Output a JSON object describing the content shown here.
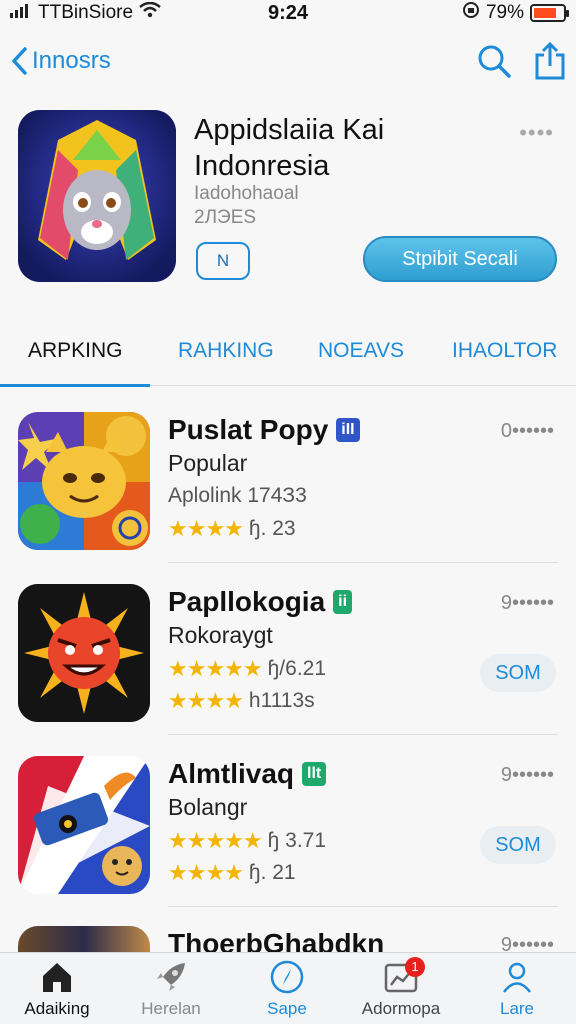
{
  "status_bar": {
    "carrier": "TTBinSiore",
    "time": "9:24",
    "battery": "79%",
    "battery_level": 0.79
  },
  "nav": {
    "back_label": "Innosrs"
  },
  "hero": {
    "title": "Appidslaiia Kai Indonresia",
    "developer_line1": "Iadohohaoal",
    "developer_line2": "2ЛЭЕS",
    "more": "••••",
    "small_button_label": "N",
    "get_button_label": "Stpibit Secali"
  },
  "tabs": [
    {
      "label": "ARPKING"
    },
    {
      "label": "RAHKING"
    },
    {
      "label": "NOEAVS"
    },
    {
      "label": "IHAOLTOR"
    }
  ],
  "apps": [
    {
      "title": "Puslat Popy",
      "badge": "iII",
      "badge_color": "#2f55c8",
      "subtitle": "Popular",
      "line1_text": "Aplolink 174З3",
      "line2_stars": "★★★★",
      "line2_text": "ɧ. 23",
      "more": "0••••••",
      "button_label": ""
    },
    {
      "title": "Papllokogia",
      "badge": "ii",
      "badge_color": "#1fa86b",
      "subtitle": "Rokoraygt",
      "line1_stars": "★★★★★",
      "line1_text": "ɧ/6.21",
      "line2_stars": "★★★★",
      "line2_text": "h1113s",
      "more": "9••••••",
      "button_label": "SOM"
    },
    {
      "title": "Almtlivaq",
      "badge": "llt",
      "badge_color": "#1fa86b",
      "subtitle": "Bolangr",
      "line1_stars": "★★★★★",
      "line1_text": "ɧ 3.71",
      "line2_stars": "★★★★",
      "line2_text": "ɧ. 21",
      "more": "9••••••",
      "button_label": "SOM"
    },
    {
      "title": "ThoerbGhabdkn",
      "more": "9••••••"
    }
  ],
  "tabbar": [
    {
      "label": "Adaiking",
      "icon": "home-icon"
    },
    {
      "label": "Herelan",
      "icon": "rocket-icon"
    },
    {
      "label": "Sape",
      "icon": "compass-icon"
    },
    {
      "label": "Adormopa",
      "icon": "chart-icon",
      "badge": "1"
    },
    {
      "label": "Lare",
      "icon": "person-icon"
    }
  ],
  "colors": {
    "accent": "#1d8bd8",
    "get_button": "#3ba9d9",
    "stars": "#f4b400",
    "notification": "#e8201c"
  }
}
